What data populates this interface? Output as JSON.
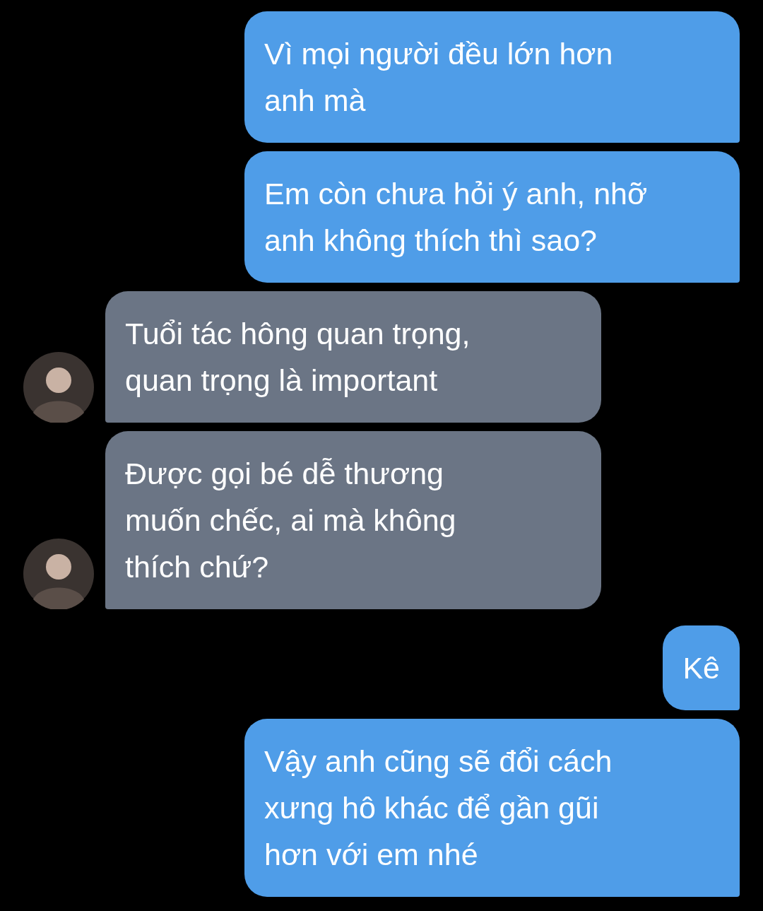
{
  "messages": [
    {
      "kind": "outgoing",
      "lines": [
        "Vì mọi người đều lớn hơn",
        "anh mà"
      ]
    },
    {
      "kind": "outgoing",
      "lines": [
        "Em còn chưa hỏi ý anh, nhỡ",
        "anh không thích thì sao?"
      ]
    },
    {
      "kind": "incoming",
      "lines": [
        "Tuổi tác hông quan trọng,",
        "quan trọng là important"
      ]
    },
    {
      "kind": "incoming",
      "lines": [
        "Được gọi bé dễ thương",
        "muốn chếc, ai mà không",
        "thích chứ?"
      ]
    },
    {
      "kind": "outgoing",
      "lines": [
        "Kê"
      ]
    },
    {
      "kind": "outgoing",
      "lines": [
        "Vậy anh cũng sẽ đổi cách",
        "xưng hô khác để gần gũi",
        "hơn với em nhé"
      ]
    }
  ]
}
